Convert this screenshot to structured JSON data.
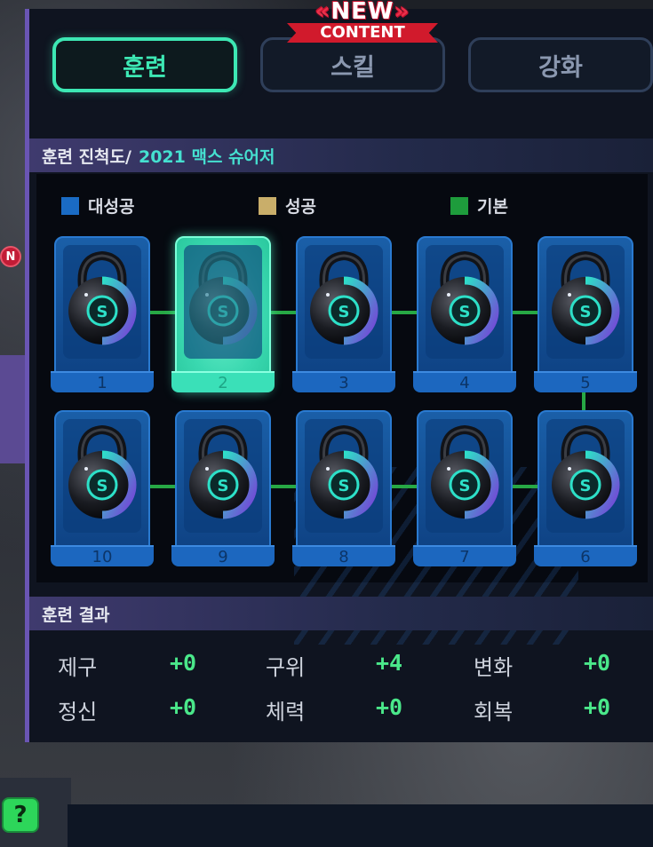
{
  "ribbon": {
    "new": "NEW",
    "content": "CONTENT"
  },
  "tabs": [
    {
      "label": "훈련",
      "active": true
    },
    {
      "label": "스킬",
      "active": false
    },
    {
      "label": "강화",
      "active": false
    }
  ],
  "progress": {
    "title": "훈련 진척도/",
    "player": "2021 맥스 슈어저",
    "legend": [
      {
        "label": "대성공",
        "color": "#1a6bc4"
      },
      {
        "label": "성공",
        "color": "#c9ae6a"
      },
      {
        "label": "기본",
        "color": "#1e9c3c"
      }
    ],
    "slots": [
      {
        "num": "1",
        "highlighted": false
      },
      {
        "num": "2",
        "highlighted": true
      },
      {
        "num": "3",
        "highlighted": false
      },
      {
        "num": "4",
        "highlighted": false
      },
      {
        "num": "5",
        "highlighted": false
      },
      {
        "num": "10",
        "highlighted": false
      },
      {
        "num": "9",
        "highlighted": false
      },
      {
        "num": "8",
        "highlighted": false
      },
      {
        "num": "7",
        "highlighted": false
      },
      {
        "num": "6",
        "highlighted": false
      }
    ],
    "badge_letter": "S"
  },
  "results": {
    "title": "훈련 결과",
    "rows": [
      [
        {
          "label": "제구",
          "value": "+0"
        },
        {
          "label": "구위",
          "value": "+4"
        },
        {
          "label": "변화",
          "value": "+0"
        }
      ],
      [
        {
          "label": "정신",
          "value": "+0"
        },
        {
          "label": "체력",
          "value": "+0"
        },
        {
          "label": "회복",
          "value": "+0"
        }
      ]
    ]
  },
  "side_badge": "N",
  "help_label": "?",
  "colors": {
    "accent": "#3de8b4",
    "value_green": "#4ae88a",
    "panel_border": "#6a55b4"
  },
  "icons": [
    "kettlebell-icon",
    "help-icon",
    "new-badge-icon"
  ]
}
